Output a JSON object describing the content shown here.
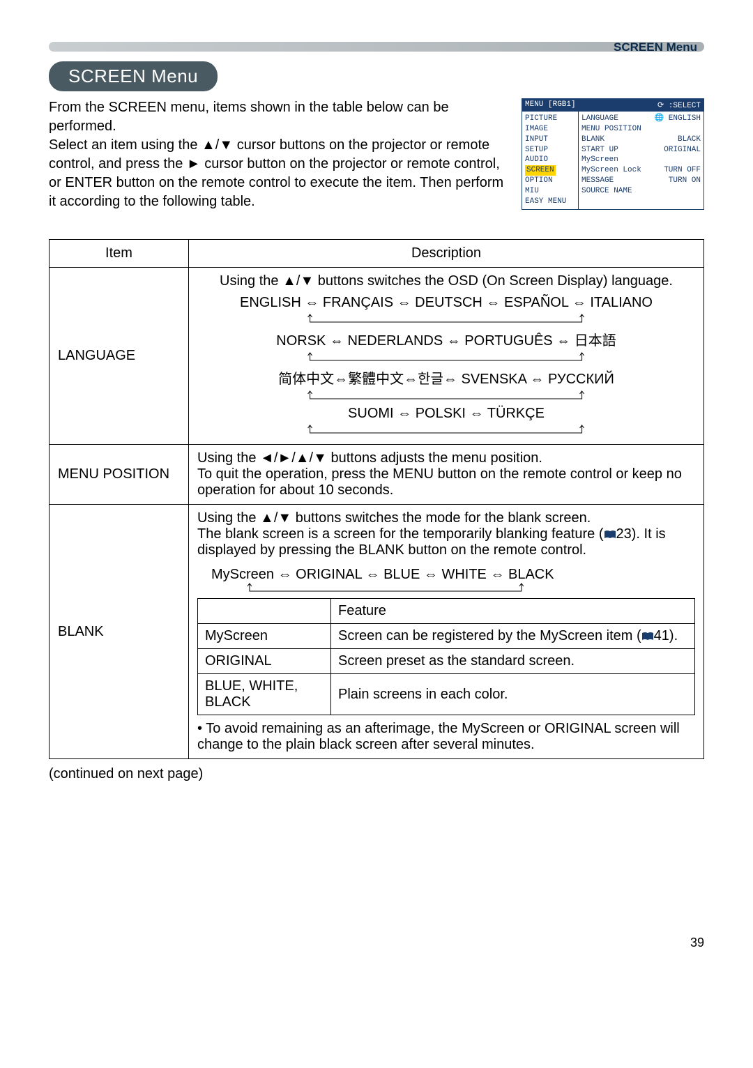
{
  "header": {
    "section": "SCREEN Menu"
  },
  "title": "SCREEN Menu",
  "intro": "From the SCREEN menu, items shown in the table below can be performed.\nSelect an item using the ▲/▼ cursor buttons on the projector or remote control, and press the ► cursor button on the projector or remote control, or ENTER button on the remote control to execute the item. Then perform it according to the following table.",
  "osd": {
    "menu_label": "MENU [RGB1]",
    "select_label": "⟳ :SELECT",
    "left": [
      "PICTURE",
      "IMAGE",
      "INPUT",
      "SETUP",
      "AUDIO",
      "SCREEN",
      "OPTION",
      "MIU",
      "EASY MENU"
    ],
    "highlighted": "SCREEN",
    "right": [
      {
        "k": "LANGUAGE",
        "v": "🌐 ENGLISH"
      },
      {
        "k": "MENU POSITION",
        "v": ""
      },
      {
        "k": "BLANK",
        "v": "BLACK"
      },
      {
        "k": "START UP",
        "v": "ORIGINAL"
      },
      {
        "k": "MyScreen",
        "v": ""
      },
      {
        "k": "MyScreen Lock",
        "v": "TURN OFF"
      },
      {
        "k": "MESSAGE",
        "v": "TURN ON"
      },
      {
        "k": "SOURCE NAME",
        "v": ""
      }
    ]
  },
  "table": {
    "head_item": "Item",
    "head_desc": "Description",
    "rows": {
      "language": {
        "item": "LANGUAGE",
        "intro": "Using the ▲/▼ buttons switches the OSD (On Screen Display) language.",
        "seq1": "ENGLISH ⇔ FRANÇAIS ⇔ DEUTSCH ⇔ ESPAÑOL ⇔ ITALIANO",
        "seq2": "NORSK ⇔ NEDERLANDS ⇔ PORTUGUÊS ⇔ 日本語",
        "seq3": "简体中文⇔繁體中文⇔한글⇔ SVENSKA ⇔ РУССКИЙ",
        "seq4": "SUOMI ⇔ POLSKI ⇔ TÜRKÇE"
      },
      "menu_position": {
        "item": "MENU POSITION",
        "desc": "Using the ◄/►/▲/▼ buttons adjusts the menu position.\nTo quit the operation, press the MENU button on the remote control or keep no operation for about 10 seconds."
      },
      "blank": {
        "item": "BLANK",
        "p1a": "Using the ▲/▼ buttons switches the mode for the blank screen.\nThe blank screen is a screen for the temporarily blanking feature (",
        "p1b": "23). It is displayed by pressing the BLANK button on the remote control.",
        "seq": "MyScreen ⇔ ORIGINAL ⇔ BLUE ⇔ WHITE ⇔ BLACK",
        "tbl": {
          "h_feature": "Feature",
          "r1a": "MyScreen",
          "r1b_pre": "Screen can be registered by the MyScreen item (",
          "r1b_post": "41).",
          "r2a": "ORIGINAL",
          "r2b": "Screen preset as the standard screen.",
          "r3a": "BLUE, WHITE, BLACK",
          "r3b": "Plain screens in each color."
        },
        "note": "• To avoid remaining as an afterimage, the MyScreen or ORIGINAL screen will change to the plain black screen after several minutes."
      }
    }
  },
  "continued": "(continued on next page)",
  "page": "39"
}
